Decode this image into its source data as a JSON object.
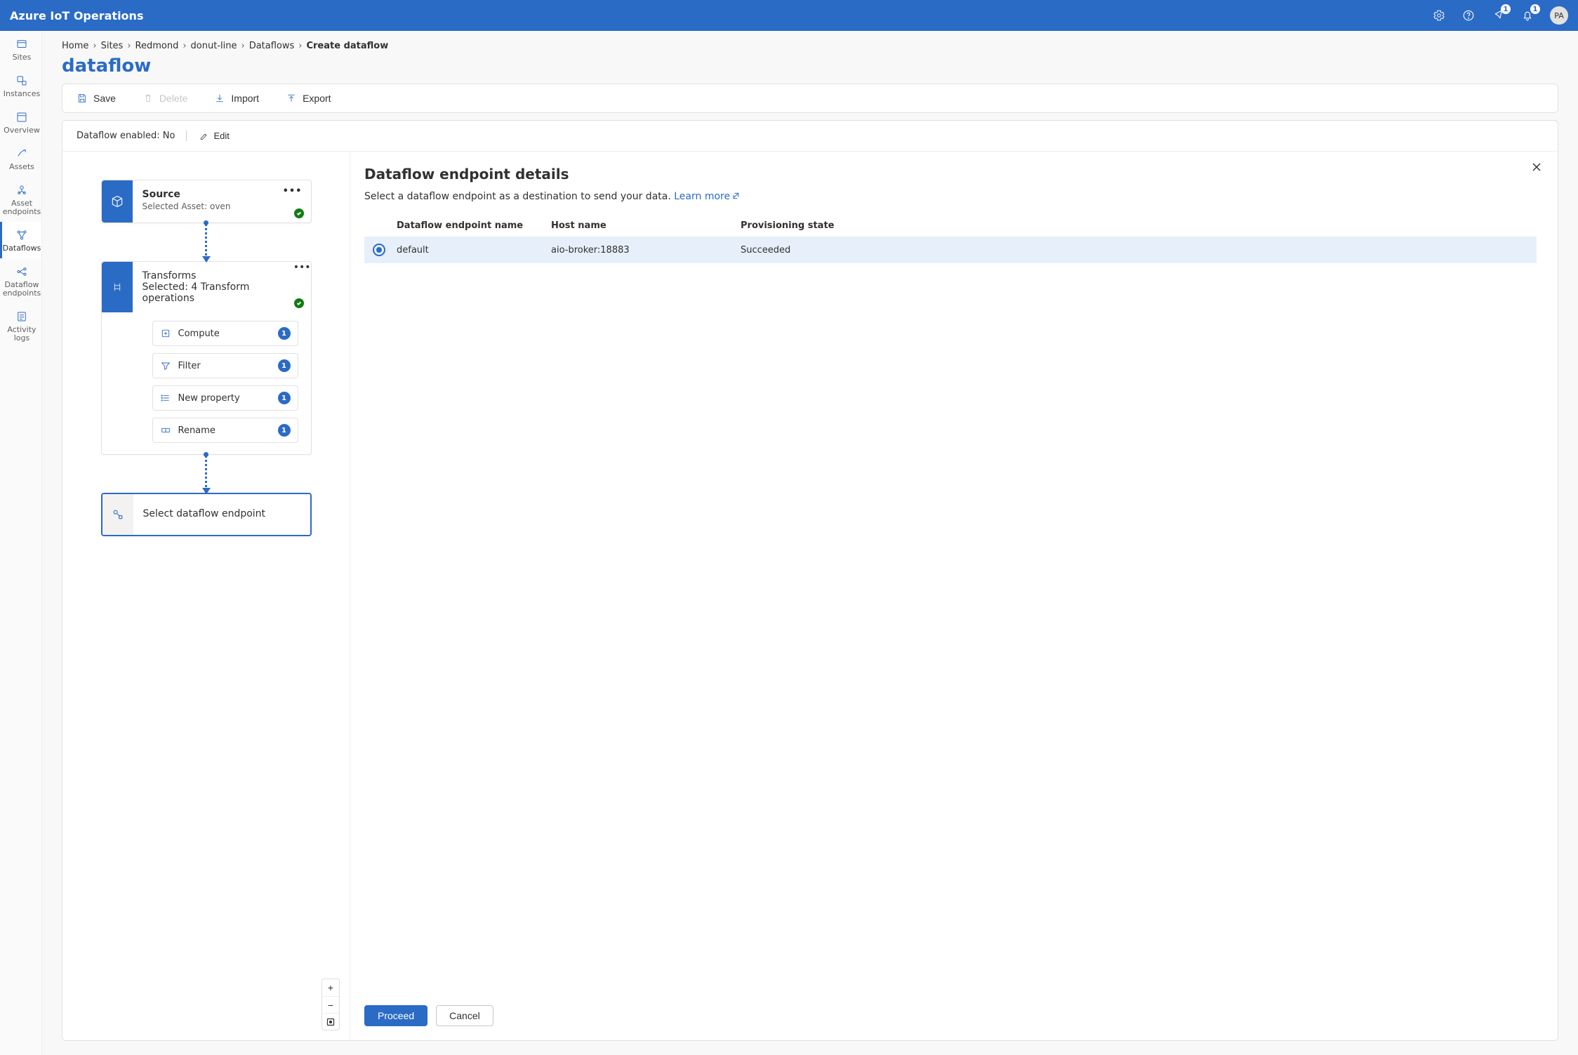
{
  "header": {
    "app_title": "Azure IoT Operations",
    "badges": {
      "b1": "1",
      "b2": "1"
    },
    "avatar_initials": "PA"
  },
  "sidebar": {
    "items": [
      {
        "label": "Sites"
      },
      {
        "label": "Instances"
      },
      {
        "label": "Overview"
      },
      {
        "label": "Assets"
      },
      {
        "label": "Asset endpoints"
      },
      {
        "label": "Dataflows"
      },
      {
        "label": "Dataflow endpoints"
      },
      {
        "label": "Activity logs"
      }
    ]
  },
  "breadcrumb": {
    "items": [
      {
        "label": "Home"
      },
      {
        "label": "Sites"
      },
      {
        "label": "Redmond"
      },
      {
        "label": "donut-line"
      },
      {
        "label": "Dataflows"
      }
    ],
    "current": "Create dataflow"
  },
  "page_title": "dataflow",
  "toolbar": {
    "save_label": "Save",
    "delete_label": "Delete",
    "import_label": "Import",
    "export_label": "Export"
  },
  "status": {
    "text": "Dataflow enabled: No",
    "edit_label": "Edit"
  },
  "canvas": {
    "source": {
      "title": "Source",
      "sub": "Selected Asset: oven"
    },
    "transforms": {
      "title": "Transforms",
      "sub": "Selected: 4 Transform operations",
      "ops": [
        {
          "label": "Compute",
          "count": "1"
        },
        {
          "label": "Filter",
          "count": "1"
        },
        {
          "label": "New property",
          "count": "1"
        },
        {
          "label": "Rename",
          "count": "1"
        }
      ]
    },
    "destination": {
      "label": "Select dataflow endpoint"
    }
  },
  "details": {
    "title": "Dataflow endpoint details",
    "desc_prefix": "Select a dataflow endpoint as a destination to send your data. ",
    "learn_more": "Learn more",
    "table": {
      "col1": "Dataflow endpoint name",
      "col2": "Host name",
      "col3": "Provisioning state",
      "rows": [
        {
          "name": "default",
          "host": "aio-broker:18883",
          "state": "Succeeded",
          "selected": true
        }
      ]
    },
    "proceed": "Proceed",
    "cancel": "Cancel"
  }
}
